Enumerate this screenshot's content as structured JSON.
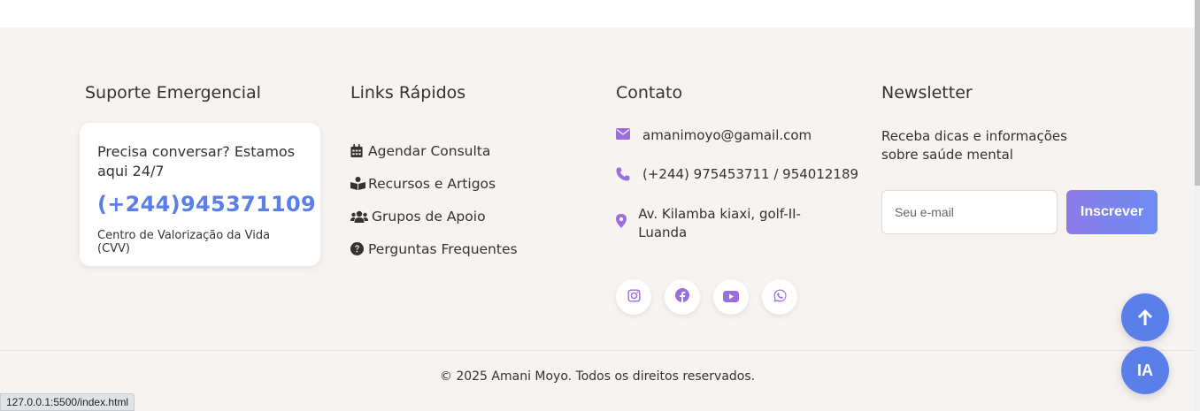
{
  "emergency": {
    "title": "Suporte Emergencial",
    "ask": "Precisa conversar? Estamos aqui 24/7",
    "phone": "(+244)945371109",
    "center": "Centro de Valorização da Vida (CVV)"
  },
  "quick_links": {
    "title": "Links Rápidos",
    "items": [
      {
        "label": "Agendar Consulta",
        "icon": "calendar-icon"
      },
      {
        "label": "Recursos e Artigos",
        "icon": "book-reader-icon"
      },
      {
        "label": "Grupos de Apoio",
        "icon": "users-icon"
      },
      {
        "label": "Perguntas Frequentes",
        "icon": "question-circle-icon"
      }
    ]
  },
  "contact": {
    "title": "Contato",
    "email": "amanimoyo@gamail.com",
    "phone": "(+244) 975453711 / 954012189",
    "address": "Av. Kilamba kiaxi, golf-II- Luanda",
    "socials": [
      "instagram-icon",
      "facebook-icon",
      "youtube-icon",
      "whatsapp-icon"
    ]
  },
  "newsletter": {
    "title": "Newsletter",
    "text": "Receba dicas e informações sobre saúde mental",
    "placeholder": "Seu e-mail",
    "button": "Inscrever"
  },
  "copyright": "© 2025 Amani Moyo. Todos os direitos reservados.",
  "fab": {
    "ia_label": "IA"
  },
  "status_url": "127.0.0.1:5500/index.html",
  "colors": {
    "footer_bg": "#f6f3f0",
    "accent_blue": "#5b7fe8",
    "accent_purple": "#9a6fdc"
  }
}
